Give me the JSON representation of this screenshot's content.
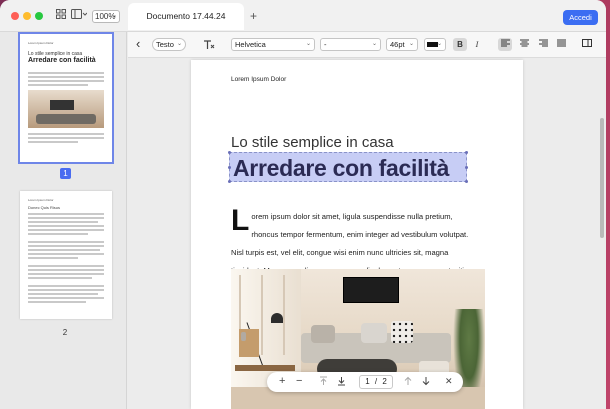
{
  "window": {
    "tab_title": "Documento 17.44.24",
    "zoom": "100%",
    "new_tab": "+",
    "login_button": "Accedi"
  },
  "sidebar": {
    "pages": [
      {
        "number": "1",
        "selected": true
      },
      {
        "number": "2",
        "selected": false
      }
    ],
    "thumb1": {
      "eyebrow": "Lorem Ipsum Dolor",
      "subtitle": "Lo stile semplice in casa",
      "title": "Arredare con facilità"
    },
    "thumb2": {
      "eyebrow": "Lorem Ipsum Dolor",
      "subtitle": "Donec Quis Risus"
    }
  },
  "format_toolbar": {
    "back": "‹",
    "mode_label": "Testo",
    "font_family": "Helvetica",
    "font_style": "-",
    "font_size": "46pt",
    "text_color": "#111111",
    "bold": "B",
    "italic": "I"
  },
  "document": {
    "eyebrow": "Lorem Ipsum Dolor",
    "subtitle": "Lo stile semplice in casa",
    "title": "Arredare con facilità",
    "dropcap": "L",
    "body": "orem ipsum dolor sit amet, ligula suspendisse nulla pretium, rhoncus tempor fermentum, enim integer ad vestibulum volutpat. Nisl turpis est, vel elit, congue wisi enim nunc ultricies sit, magna tincidunt. Maecenas aliquam maecenas ligula nostra, accumsan taciti. Sociis mauris in integer, a dolor netus non dui aliquet, sagittis felis sodales, dolor sociis mauris, vel eu libero cras. Faucibus at. Arcu habitasse elementum."
  },
  "page_nav": {
    "zoom_in": "+",
    "zoom_out": "−",
    "current_page": "1",
    "separator": "/",
    "total_pages": "2",
    "close": "✕"
  },
  "colors": {
    "accent": "#3b6df2",
    "selection": "#c7cdf5"
  }
}
